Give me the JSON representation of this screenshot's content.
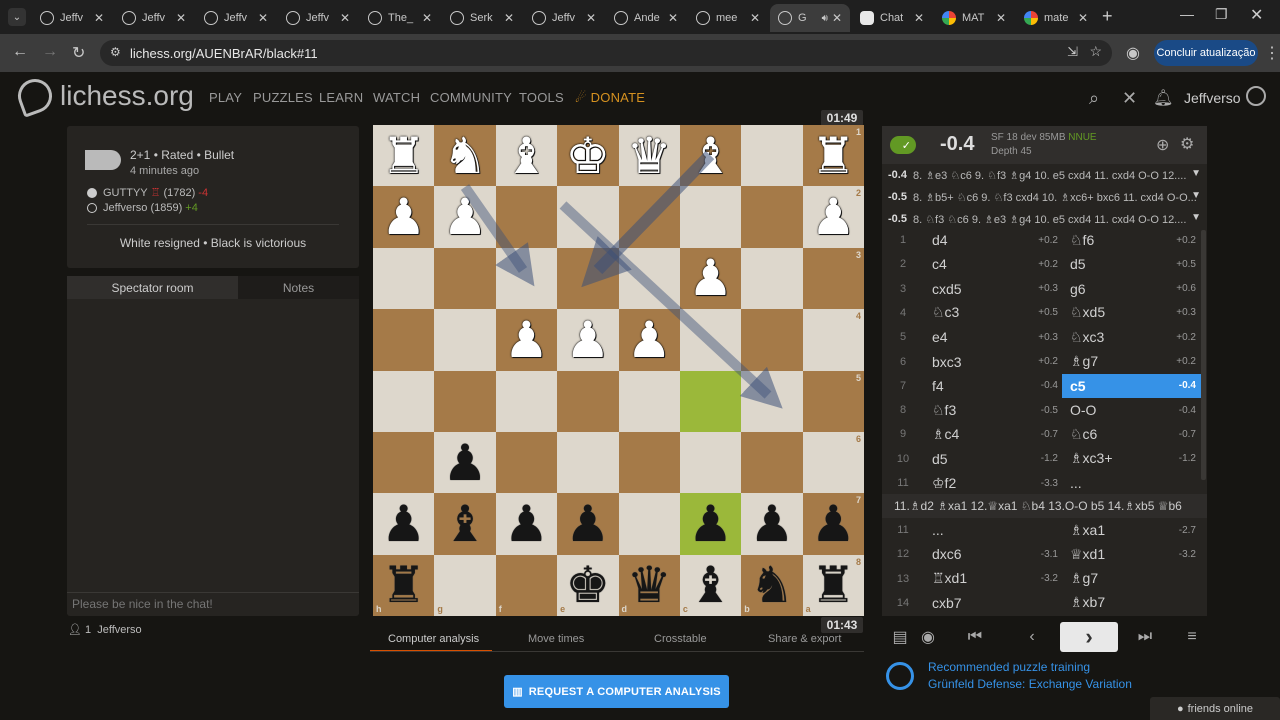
{
  "browser": {
    "tabs": [
      {
        "label": "Jeffv",
        "icon": "lichess-icon"
      },
      {
        "label": "Jeffv",
        "icon": "lichess-icon"
      },
      {
        "label": "Jeffv",
        "icon": "lichess-icon"
      },
      {
        "label": "Jeffv",
        "icon": "lichess-icon"
      },
      {
        "label": "The_",
        "icon": "lichess-icon"
      },
      {
        "label": "Serk",
        "icon": "lichess-icon"
      },
      {
        "label": "Jeffv",
        "icon": "lichess-icon"
      },
      {
        "label": "Ande",
        "icon": "lichess-icon"
      },
      {
        "label": "mee",
        "icon": "lichess-icon"
      },
      {
        "label": "G",
        "icon": "lichess-icon"
      },
      {
        "label": "Chat",
        "icon": "chatgpt-icon"
      },
      {
        "label": "MAT",
        "icon": "google-icon"
      },
      {
        "label": "mate",
        "icon": "google-icon"
      }
    ],
    "url": "lichess.org/AUENBrAR/black#11",
    "update_button": "Concluir atualização"
  },
  "site": {
    "logo": "lichess.org",
    "nav": [
      "PLAY",
      "PUZZLES",
      "LEARN",
      "WATCH",
      "COMMUNITY",
      "TOOLS"
    ],
    "donate": "DONATE",
    "username": "Jeffverso"
  },
  "game": {
    "type": "2+1 • Rated • Bullet",
    "time_ago": "4 minutes ago",
    "white_player": "GUTTYY",
    "white_rating": "(1782)",
    "white_diff": "-4",
    "black_player": "Jeffverso (1859)",
    "black_diff": "+4",
    "result": "White resigned • Black is victorious"
  },
  "chat": {
    "tab_spectator": "Spectator room",
    "tab_notes": "Notes",
    "placeholder": "Please be nice in the chat!",
    "spectators_count": "1",
    "spectator_name": "Jeffverso"
  },
  "board": {
    "top_clock": "01:49",
    "bottom_clock": "01:43",
    "ranks": [
      "1",
      "2",
      "3",
      "4",
      "5",
      "6",
      "7",
      "8"
    ],
    "files": [
      "h",
      "g",
      "f",
      "e",
      "d",
      "c",
      "b",
      "a"
    ],
    "squares": [
      [
        "wR",
        "wN",
        "wB",
        "wK",
        "wQ",
        "wB",
        "",
        "wR"
      ],
      [
        "wP",
        "wP",
        "",
        "",
        "",
        "",
        "",
        "wP"
      ],
      [
        "",
        "",
        "",
        "",
        "",
        "wP",
        "",
        ""
      ],
      [
        "",
        "",
        "wP",
        "wP",
        "wP",
        "",
        "",
        ""
      ],
      [
        "",
        "",
        "",
        "",
        "",
        "",
        "",
        ""
      ],
      [
        "",
        "bP",
        "",
        "",
        "",
        "",
        "",
        ""
      ],
      [
        "bP",
        "bB",
        "bP",
        "bP",
        "",
        "bP",
        "bP",
        "bP"
      ],
      [
        "bR",
        "",
        "",
        "bK",
        "bQ",
        "bB",
        "bN",
        "bR"
      ]
    ]
  },
  "board_tabs": [
    "Computer analysis",
    "Move times",
    "Crosstable",
    "Share & export"
  ],
  "request_analysis": "REQUEST A COMPUTER ANALYSIS",
  "engine": {
    "eval": "-0.4",
    "name": "SF 18 dev 85MB",
    "nnue": "NNUE",
    "depth": "Depth 45",
    "lines": [
      {
        "eval": "-0.4",
        "line": "8. ♗e3 ♘c6 9. ♘f3 ♗g4 10. e5 cxd4 11. cxd4 O-O 12...."
      },
      {
        "eval": "-0.5",
        "line": "8. ♗b5+ ♘c6 9. ♘f3 cxd4 10. ♗xc6+ bxc6 11. cxd4 O-O..."
      },
      {
        "eval": "-0.5",
        "line": "8. ♘f3 ♘c6 9. ♗e3 ♗g4 10. e5 cxd4 11. cxd4 O-O 12...."
      }
    ]
  },
  "moves": [
    {
      "n": "1",
      "w": "d4",
      "we": "+0.2",
      "b": "♘f6",
      "be": "+0.2"
    },
    {
      "n": "2",
      "w": "c4",
      "we": "+0.2",
      "b": "d5",
      "be": "+0.5"
    },
    {
      "n": "3",
      "w": "cxd5",
      "we": "+0.3",
      "b": "g6",
      "be": "+0.6"
    },
    {
      "n": "4",
      "w": "♘c3",
      "we": "+0.5",
      "b": "♘xd5",
      "be": "+0.3"
    },
    {
      "n": "5",
      "w": "e4",
      "we": "+0.3",
      "b": "♘xc3",
      "be": "+0.2"
    },
    {
      "n": "6",
      "w": "bxc3",
      "we": "+0.2",
      "b": "♗g7",
      "be": "+0.2"
    },
    {
      "n": "7",
      "w": "f4",
      "we": "-0.4",
      "b": "c5",
      "be": "-0.4"
    },
    {
      "n": "8",
      "w": "♘f3",
      "we": "-0.5",
      "b": "O-O",
      "be": "-0.4"
    },
    {
      "n": "9",
      "w": "♗c4",
      "we": "-0.7",
      "b": "♘c6",
      "be": "-0.7"
    },
    {
      "n": "10",
      "w": "d5",
      "we": "-1.2",
      "b": "♗xc3+",
      "be": "-1.2"
    },
    {
      "n": "11",
      "w": "♔f2",
      "we": "-3.3",
      "b": "...",
      "be": ""
    }
  ],
  "variation": "11.♗d2 ♗xa1 12.♕xa1 ♘b4 13.O-O b5 14.♗xb5 ♕b6",
  "moves_after": [
    {
      "n": "11",
      "w": "...",
      "we": "",
      "b": "♗xa1",
      "be": "-2.7"
    },
    {
      "n": "12",
      "w": "dxc6",
      "we": "-3.1",
      "b": "♕xd1",
      "be": "-3.2"
    },
    {
      "n": "13",
      "w": "♖xd1",
      "we": "-3.2",
      "b": "♗g7",
      "be": ""
    },
    {
      "n": "14",
      "w": "cxb7",
      "we": "",
      "b": "♗xb7",
      "be": ""
    }
  ],
  "puzzle": {
    "title": "Recommended puzzle training",
    "subtitle": "Grünfeld Defense: Exchange Variation"
  },
  "friends": "friends online",
  "colors": {
    "accent": "#3692e7",
    "highlight": "#9bb83a",
    "donate": "#d59120"
  }
}
